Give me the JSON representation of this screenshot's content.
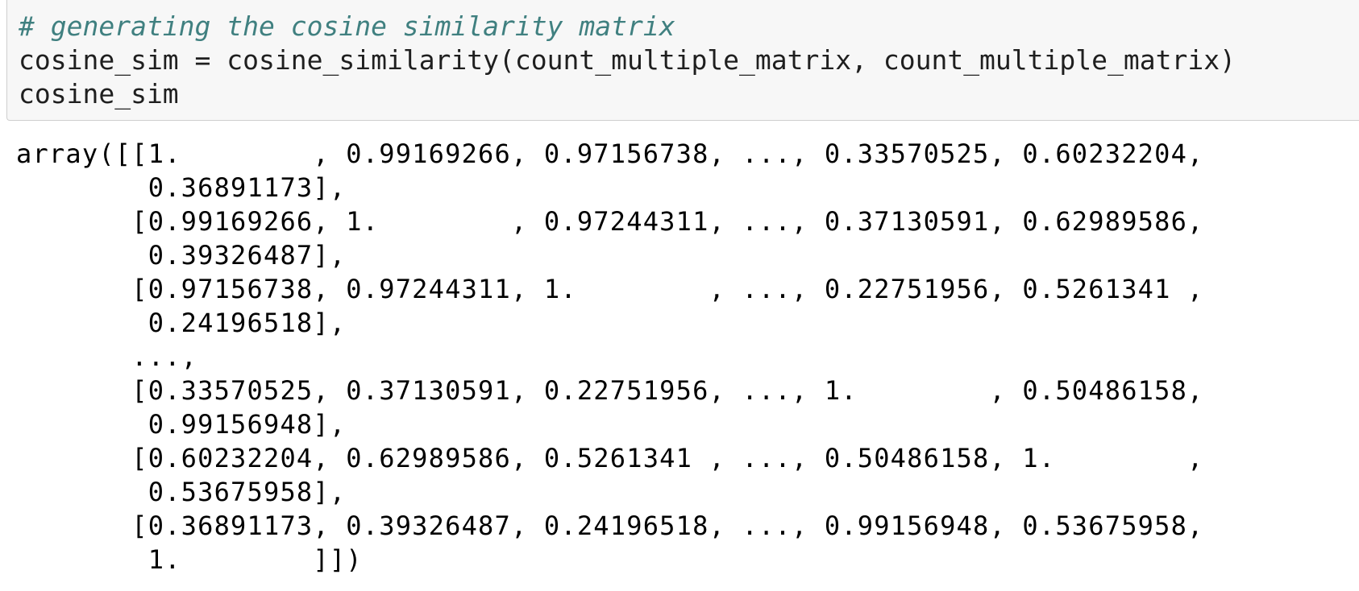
{
  "input_cell": {
    "lines": [
      "# generating the cosine similarity matrix",
      "cosine_sim = cosine_similarity(count_multiple_matrix, count_multiple_matrix)",
      "cosine_sim"
    ]
  },
  "output_cell": {
    "lines": [
      "array([[1.        , 0.99169266, 0.97156738, ..., 0.33570525, 0.60232204,",
      "        0.36891173],",
      "       [0.99169266, 1.        , 0.97244311, ..., 0.37130591, 0.62989586,",
      "        0.39326487],",
      "       [0.97156738, 0.97244311, 1.        , ..., 0.22751956, 0.5261341 ,",
      "        0.24196518],",
      "       ...,",
      "       [0.33570525, 0.37130591, 0.22751956, ..., 1.        , 0.50486158,",
      "        0.99156948],",
      "       [0.60232204, 0.62989586, 0.5261341 , ..., 0.50486158, 1.        ,",
      "        0.53675958],",
      "       [0.36891173, 0.39326487, 0.24196518, ..., 0.99156948, 0.53675958,",
      "        1.        ]])"
    ]
  },
  "colors": {
    "cell_background": "#f7f7f7",
    "cell_border": "#cfcfcf",
    "comment": "#408080",
    "code_text": "#1f1f1f",
    "output_text": "#000000"
  }
}
